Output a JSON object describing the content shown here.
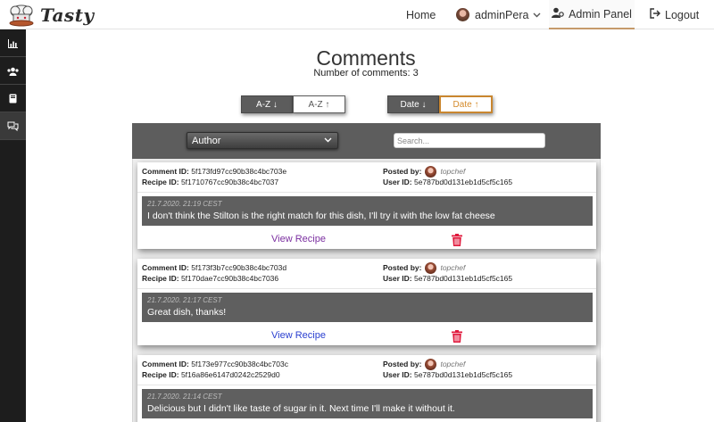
{
  "app": {
    "brand": "Tasty"
  },
  "nav": {
    "home": "Home",
    "user": "adminPera",
    "admin": "Admin Panel",
    "logout": "Logout"
  },
  "page": {
    "title": "Comments",
    "count_text": "Number of comments: 3"
  },
  "sort": {
    "az_down": "A-Z ↓",
    "az_up": "A-Z ↑",
    "date_down": "Date ↓",
    "date_up": "Date ↑"
  },
  "filter": {
    "author_select": "Author",
    "search_placeholder": "Search..."
  },
  "labels": {
    "comment_id": "Comment ID:",
    "recipe_id": "Recipe ID:",
    "posted_by": "Posted by:",
    "user_id": "User ID:",
    "view_recipe": "View Recipe"
  },
  "colors": {
    "view_link_1": "#7b2fa0",
    "view_link_2": "#2a3fd0",
    "trash": "#e0193c",
    "active_sort": "#c9862f"
  },
  "comments": [
    {
      "comment_id": "5f173fd97cc90b38c4bc703e",
      "recipe_id": "5f1710767cc90b38c4bc7037",
      "posted_by": "topchef",
      "user_id": "5e787bd0d131eb1d5cf5c165",
      "date": "21.7.2020. 21:19 CEST",
      "text": "I don't think the Stilton is the right match for this dish, I'll try it with the low fat cheese"
    },
    {
      "comment_id": "5f173f3b7cc90b38c4bc703d",
      "recipe_id": "5f170dae7cc90b38c4bc7036",
      "posted_by": "topchef",
      "user_id": "5e787bd0d131eb1d5cf5c165",
      "date": "21.7.2020. 21:17 CEST",
      "text": "Great dish, thanks!"
    },
    {
      "comment_id": "5f173e977cc90b38c4bc703c",
      "recipe_id": "5f16a86e6147d0242c2529d0",
      "posted_by": "topchef",
      "user_id": "5e787bd0d131eb1d5cf5c165",
      "date": "21.7.2020. 21:14 CEST",
      "text": "Delicious but I didn't like taste of sugar in it. Next time I'll make it without it."
    }
  ]
}
